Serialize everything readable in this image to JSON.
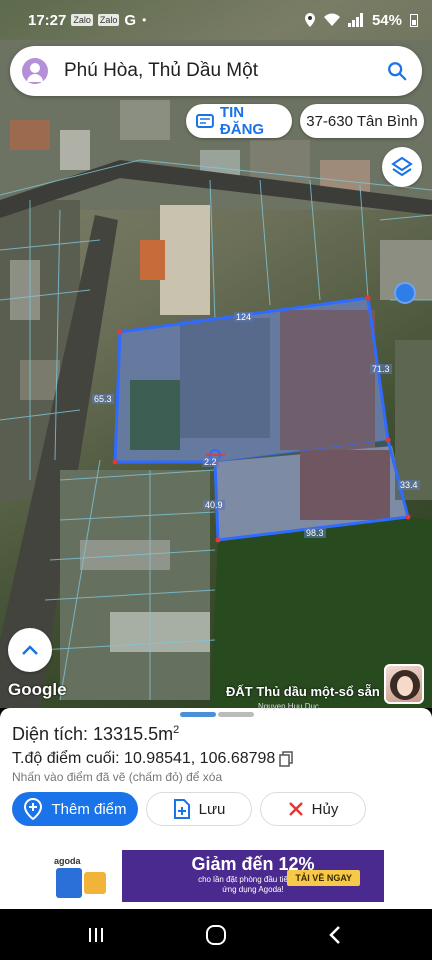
{
  "status_bar": {
    "time": "17:27",
    "mini_icons": [
      "Zalo",
      "Zalo"
    ],
    "g_label": "G",
    "dot": "•",
    "battery": "54%"
  },
  "search": {
    "query": "Phú Hòa, Thủ Dầu Một"
  },
  "chips": {
    "tin_dang": "TIN ĐĂNG",
    "code": "37-630 Tân Bình"
  },
  "map": {
    "edge_labels": [
      "124",
      "71.3",
      "65.3",
      "2.2",
      "40.9",
      "33.4",
      "98.3"
    ],
    "google": "Google",
    "ad_title": "ĐẤT Thủ dầu một-sổ sẵn",
    "ad_author": "Nguyen Huu Duc"
  },
  "sheet": {
    "area_label": "Diện tích: 13315.5m",
    "area_sup": "2",
    "coords": "T.độ điểm cuối: 10.98541, 106.68798",
    "hint": "Nhấn vào điểm đã vẽ (chấm đỏ) để xóa",
    "add_point": "Thêm điểm",
    "save": "Lưu",
    "cancel": "Hủy"
  },
  "banner": {
    "brand": "agoda",
    "headline": "Giảm đến 12%",
    "sub1": "cho lần đặt phòng đầu tiên qua",
    "sub2": "ứng dụng Agoda!",
    "cta": "TẢI VỀ NGAY"
  },
  "colors": {
    "accent": "#1a73e8",
    "parcel": "#2f6bff",
    "ad_bg": "#4b2a8f"
  }
}
